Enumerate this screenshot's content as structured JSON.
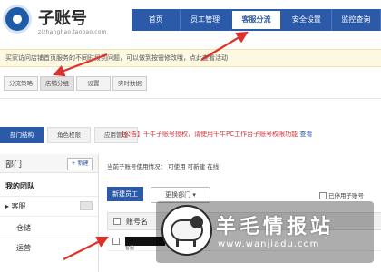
{
  "header": {
    "logo_title": "子账号",
    "logo_subtitle": "zizhanghao.taobao.com",
    "nav": [
      "首页",
      "员工管理",
      "客服分流",
      "安全设置",
      "监控查询"
    ],
    "active_nav_index": 2
  },
  "notice": {
    "text": "买家访问店铺首页服务的不同时段到问题，可以做到按需修改哦，点此查看活动"
  },
  "subtabs": [
    "分流策略",
    "店铺分组",
    "设置",
    "实时数据"
  ],
  "org_tabs": [
    "部门结构",
    "角色权限",
    "应用管理"
  ],
  "alert": {
    "text": "【公告】千牛子账号授权，请使用千牛PC工作台子账号权限功能",
    "link": "查看"
  },
  "left_panel": {
    "title": "部门",
    "new_button": "+ 新建",
    "root": "我的团队",
    "items": [
      "客服",
      "仓储",
      "运营"
    ]
  },
  "main": {
    "filter_text": "当前子账号使用情况：  可使用      可新建      在线",
    "new_employee_button": "新建员工",
    "change_dept_button": "更换部门",
    "stop_checkbox_label": "已停用子账号",
    "table_header_account": "账号名",
    "row1_sub": "客服"
  },
  "watermark": {
    "title": "羊毛情报站",
    "url": "www.wanjiadu.com"
  },
  "colors": {
    "brand_blue": "#2b5aa8",
    "notice_bg": "#fdf8e2",
    "alert_red": "#d33333"
  }
}
